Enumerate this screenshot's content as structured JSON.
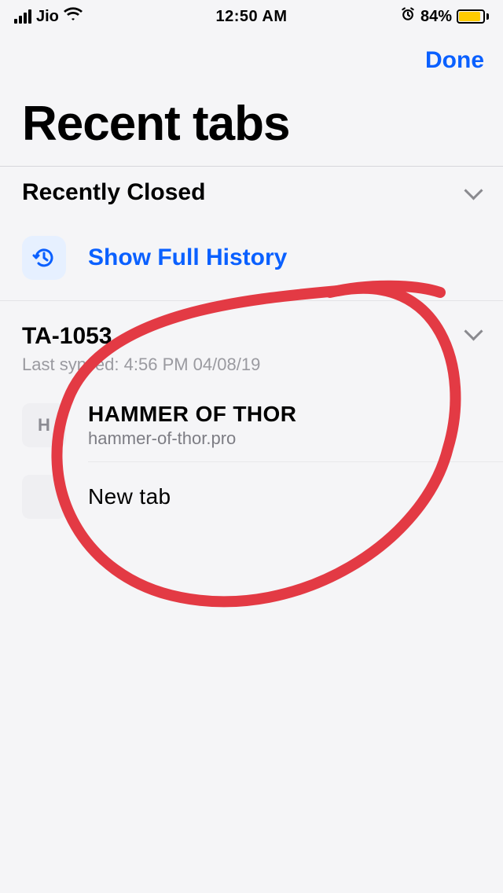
{
  "status_bar": {
    "carrier": "Jio",
    "time": "12:50 AM",
    "battery_percent": "84%"
  },
  "nav": {
    "done_label": "Done"
  },
  "page": {
    "title": "Recent tabs"
  },
  "sections": {
    "recently_closed": {
      "title": "Recently Closed",
      "show_history_label": "Show Full History"
    },
    "device": {
      "name": "TA-1053",
      "last_synced_prefix": "Last synced: ",
      "last_synced": "4:56 PM 04/08/19",
      "tabs": [
        {
          "favicon_letter": "H",
          "title": "HAMMER OF THOR",
          "url": "hammer-of-thor.pro"
        },
        {
          "favicon_letter": "",
          "title": "New tab",
          "url": ""
        }
      ]
    }
  }
}
